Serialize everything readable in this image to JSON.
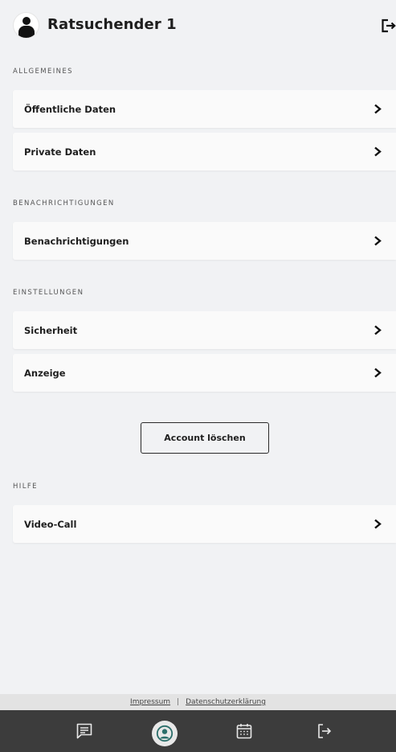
{
  "header": {
    "username": "Ratsuchender 1",
    "avatar_icon": "user-avatar-icon",
    "logout_icon": "logout-icon"
  },
  "sections": [
    {
      "label": "ALLGEMEINES",
      "items": [
        "Öffentliche Daten",
        "Private Daten"
      ]
    },
    {
      "label": "BENACHRICHTIGUNGEN",
      "items": [
        "Benachrichtigungen"
      ]
    },
    {
      "label": "EINSTELLUNGEN",
      "items": [
        "Sicherheit",
        "Anzeige"
      ]
    },
    {
      "label": "HILFE",
      "items": [
        "Video-Call"
      ]
    }
  ],
  "delete_account": {
    "label": "Account löschen"
  },
  "footer": {
    "impressum": "Impressum",
    "separator": "|",
    "privacy": "Datenschutzerklärung"
  },
  "bottom_nav": {
    "items": [
      {
        "icon": "messages-icon",
        "active": false
      },
      {
        "icon": "profile-icon",
        "active": true
      },
      {
        "icon": "calendar-icon",
        "active": false
      },
      {
        "icon": "logout-icon",
        "active": false
      }
    ],
    "active_color": "#2b6e6a"
  }
}
